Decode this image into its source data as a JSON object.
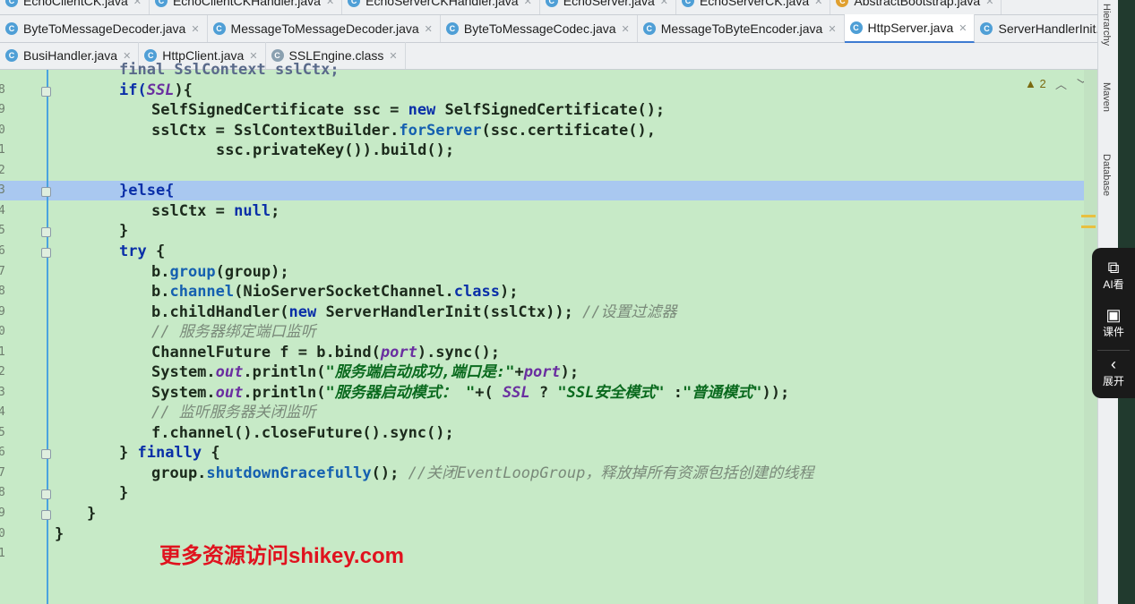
{
  "tabs_row1": [
    {
      "label": "EchoClientCK.java"
    },
    {
      "label": "EchoClientCKHandler.java"
    },
    {
      "label": "EchoServerCKHandler.java"
    },
    {
      "label": "EchoServer.java"
    },
    {
      "label": "EchoServerCK.java"
    },
    {
      "label": "AbstractBootstrap.java"
    }
  ],
  "tabs_row2": [
    {
      "label": "ByteToMessageDecoder.java"
    },
    {
      "label": "MessageToMessageDecoder.java"
    },
    {
      "label": "ByteToMessageCodec.java"
    },
    {
      "label": "MessageToByteEncoder.java"
    },
    {
      "label": "HttpServer.java"
    },
    {
      "label": "ServerHandlerInit.java"
    }
  ],
  "tabs_row3": [
    {
      "label": "BusiHandler.java"
    },
    {
      "label": "HttpClient.java"
    },
    {
      "label": "SSLEngine.class"
    }
  ],
  "editor": {
    "warning_count": "2",
    "line_numbers": [
      "",
      "8",
      "9",
      "0",
      "1",
      "2",
      "3",
      "4",
      "5",
      "6",
      "7",
      "8",
      "9",
      "0",
      "1",
      "2",
      "3",
      "4",
      "5",
      "6",
      "7",
      "8",
      "9",
      "0",
      "1"
    ],
    "lines": {
      "l0": "final SslContext sslCtx;",
      "l1a": "if(",
      "l1b": "SSL",
      "l1c": "){",
      "l2a": "SelfSignedCertificate ssc = ",
      "l2b": "new",
      "l2c": " SelfSignedCertificate();",
      "l3a": "sslCtx = SslContextBuilder.",
      "l3b": "forServer",
      "l3c": "(ssc.certificate(),",
      "l4": "ssc.privateKey()).build();",
      "l6": "}else{",
      "l7a": "sslCtx = ",
      "l7b": "null",
      "l7c": ";",
      "l8": "}",
      "l9a": "try",
      "l9b": " {",
      "l10a": "b.",
      "l10b": "group",
      "l10c": "(group);",
      "l11a": "b.",
      "l11b": "channel",
      "l11c": "(NioServerSocketChannel.",
      "l11d": "class",
      "l11e": ");",
      "l12a": "b.childHandler(",
      "l12b": "new",
      "l12c": " ServerHandlerInit(sslCtx)); ",
      "l12d": "//设置过滤器",
      "l13": "// 服务器绑定端口监听",
      "l14a": "ChannelFuture f = b.bind(",
      "l14b": "port",
      "l14c": ").sync();",
      "l15a": "System.",
      "l15b": "out",
      "l15c": ".println(",
      "l15d": "\"服务端启动成功,端口是:\"",
      "l15e": "+",
      "l15f": "port",
      "l15g": ");",
      "l16a": "System.",
      "l16b": "out",
      "l16c": ".println(",
      "l16d": "\"服务器启动模式： \"",
      "l16e": "+( ",
      "l16f": "SSL",
      "l16g": " ? ",
      "l16h": "\"SSL安全模式\"",
      "l16i": " :",
      "l16j": "\"普通模式\"",
      "l16k": "));",
      "l17": "// 监听服务器关闭监听",
      "l18": "f.channel().closeFuture().sync();",
      "l19a": "} ",
      "l19b": "finally",
      "l19c": " {",
      "l20a": "group.",
      "l20b": "shutdownGracefully",
      "l20c": "(); ",
      "l20d": "//关闭EventLoopGroup，释放掉所有资源包括创建的线程",
      "l21": "}",
      "l22": "}",
      "l23": "}"
    }
  },
  "watermark": "更多资源访问shikey.com",
  "right_tools": [
    "Hierarchy",
    "Maven",
    "Database"
  ],
  "side_panel": [
    {
      "label": "AI看"
    },
    {
      "label": "课件"
    },
    {
      "label": "展开"
    }
  ]
}
